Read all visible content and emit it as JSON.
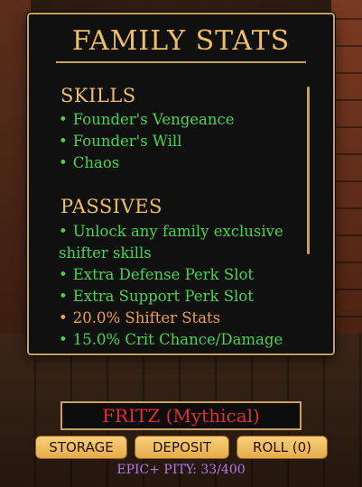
{
  "panel": {
    "title": "FAMILY STATS",
    "skills_heading": "SKILLS",
    "skills": [
      "Founder's Vengeance",
      "Founder's Will",
      "Chaos"
    ],
    "passives_heading": "PASSIVES",
    "passives": [
      "Unlock any family exclusive shifter skills",
      "Extra Defense Perk Slot",
      "Extra Support Perk Slot",
      "20.0% Shifter Stats",
      "15.0% Crit Chance/Damage"
    ]
  },
  "bullet": "•",
  "character": {
    "label": "FRITZ (Mythical)"
  },
  "buttons": {
    "storage": "STORAGE",
    "deposit": "DEPOSIT",
    "roll": "ROLL (0)"
  },
  "pity": "EPIC+ PITY: 33/400",
  "colors": {
    "gold": "#f0bf64",
    "border": "#c9a15a",
    "green": "#46d54e",
    "orange": "#f0a04a",
    "red": "#e22f2f",
    "purple": "#b279e2"
  }
}
